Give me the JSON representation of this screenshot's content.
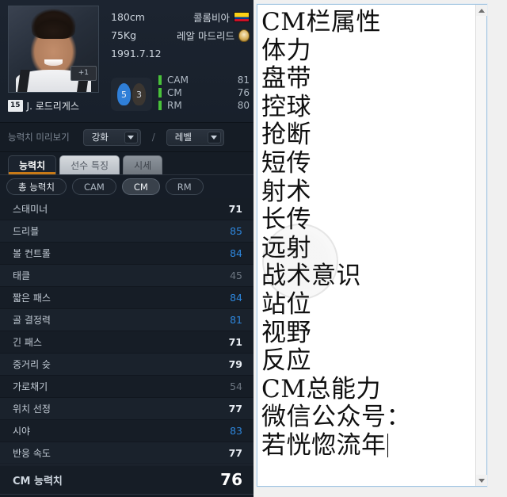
{
  "player": {
    "name": "J. 로드리게스",
    "jersey_number": "15",
    "height": "180cm",
    "weight": "75Kg",
    "birthdate": "1991.7.12",
    "nationality": "콜롬비아",
    "club": "레알 마드리드",
    "photo_badge": "+1",
    "skill_moves": "5",
    "weak_foot": "3",
    "positions": [
      {
        "name": "CAM",
        "value": "81"
      },
      {
        "name": "CM",
        "value": "76"
      },
      {
        "name": "RM",
        "value": "80"
      }
    ]
  },
  "preview": {
    "label": "능력치 미리보기",
    "separator": "/",
    "dropdowns": [
      {
        "name": "enhance",
        "value": "강화"
      },
      {
        "name": "level",
        "value": "레벨"
      }
    ]
  },
  "tabs": [
    {
      "label": "능력치",
      "active": true
    },
    {
      "label": "선수 특징",
      "active": false
    },
    {
      "label": "시세",
      "active": false
    }
  ],
  "pills": [
    {
      "label": "총 능력치",
      "selected": false
    },
    {
      "label": "CAM",
      "selected": false
    },
    {
      "label": "CM",
      "selected": true
    },
    {
      "label": "RM",
      "selected": false
    }
  ],
  "stats": [
    {
      "name": "스태미너",
      "value": "71",
      "trend": "none"
    },
    {
      "name": "드리블",
      "value": "85",
      "trend": "up"
    },
    {
      "name": "볼 컨트롤",
      "value": "84",
      "trend": "up"
    },
    {
      "name": "태클",
      "value": "45",
      "trend": "down"
    },
    {
      "name": "짧은 패스",
      "value": "84",
      "trend": "up"
    },
    {
      "name": "골 결정력",
      "value": "81",
      "trend": "up"
    },
    {
      "name": "긴 패스",
      "value": "71",
      "trend": "none"
    },
    {
      "name": "중거리 슛",
      "value": "79",
      "trend": "none"
    },
    {
      "name": "가로채기",
      "value": "54",
      "trend": "down"
    },
    {
      "name": "위치 선정",
      "value": "77",
      "trend": "none"
    },
    {
      "name": "시야",
      "value": "83",
      "trend": "up"
    },
    {
      "name": "반응 속도",
      "value": "77",
      "trend": "none"
    }
  ],
  "total": {
    "name": "CM 능력치",
    "value": "76"
  },
  "editor": {
    "content": "CM栏属性\n体力\n盘带\n控球\n抢断\n短传\n射术\n长传\n远射\n战术意识\n站位\n视野\n反应\nCM总能力\n微信公众号：\n若恍惚流年"
  },
  "colors": {
    "accent_orange": "#c87a17",
    "value_up": "#2e87dd",
    "value_down": "#6c7580",
    "position_bar": "#49c23a",
    "panel_bg": "#161d26",
    "editor_border": "#9fc3e0"
  }
}
